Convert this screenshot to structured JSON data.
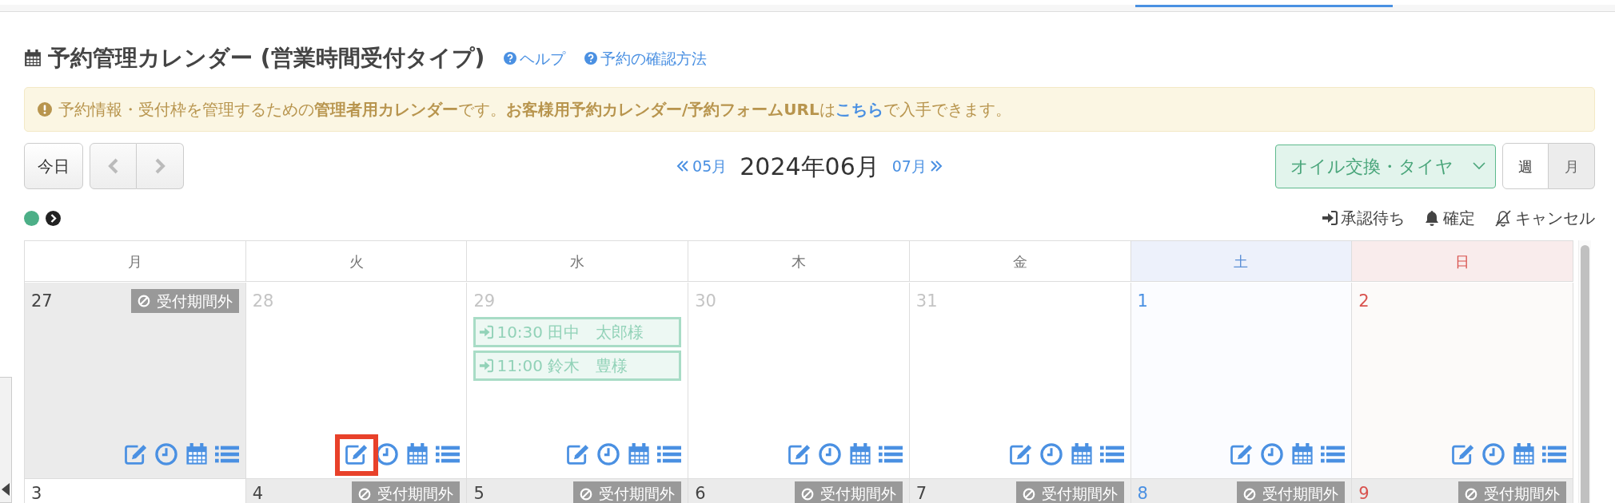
{
  "title": "予約管理カレンダー (営業時間受付タイプ)",
  "help_links": [
    "ヘルプ",
    "予約の確認方法"
  ],
  "notice": {
    "text": "予約情報・受付枠を管理するための**管理者用カレンダー**です。**お客様用予約カレンダー/予約フォームURL**は",
    "link": "こちら",
    "text_after": "で入手できます。"
  },
  "toolbar": {
    "today": "今日",
    "prev_month": "05月",
    "current_month": "2024年06月",
    "next_month": "07月",
    "category": "オイル交換・タイヤ",
    "views": [
      {
        "label": "週",
        "selected": false
      },
      {
        "label": "月",
        "selected": true
      }
    ]
  },
  "legend": [
    {
      "kind": "pending",
      "label": "承認待ち"
    },
    {
      "kind": "confirmed",
      "label": "確定"
    },
    {
      "kind": "cancelled",
      "label": "キャンセル"
    }
  ],
  "calendar": {
    "columns": [
      {
        "label": "月",
        "kind": "weekday"
      },
      {
        "label": "火",
        "kind": "weekday"
      },
      {
        "label": "水",
        "kind": "weekday"
      },
      {
        "label": "木",
        "kind": "weekday"
      },
      {
        "label": "金",
        "kind": "weekday"
      },
      {
        "label": "土",
        "kind": "saturday"
      },
      {
        "label": "日",
        "kind": "sunday"
      }
    ],
    "weeks": [
      {
        "days": [
          {
            "day": "27",
            "muted": false,
            "closed": true,
            "badge": "受付期間外",
            "tools": true
          },
          {
            "day": "28",
            "muted": true,
            "closed": false,
            "tools": true,
            "highlight": true
          },
          {
            "day": "29",
            "muted": true,
            "closed": false,
            "tools": true,
            "events": [
              {
                "kind": "pending",
                "text": "10:30 田中　太郎様"
              },
              {
                "kind": "pending",
                "text": "11:00 鈴木　豊様"
              }
            ]
          },
          {
            "day": "30",
            "muted": true,
            "closed": false,
            "tools": true
          },
          {
            "day": "31",
            "muted": true,
            "closed": false,
            "tools": true
          },
          {
            "day": "1",
            "muted": false,
            "closed": false,
            "tools": true
          },
          {
            "day": "2",
            "muted": false,
            "closed": false,
            "tools": true
          }
        ]
      },
      {
        "days": [
          {
            "day": "3",
            "muted": false,
            "closed": false
          },
          {
            "day": "4",
            "muted": false,
            "closed": true,
            "badge": "受付期間外"
          },
          {
            "day": "5",
            "muted": false,
            "closed": true,
            "badge": "受付期間外"
          },
          {
            "day": "6",
            "muted": false,
            "closed": true,
            "badge": "受付期間外"
          },
          {
            "day": "7",
            "muted": false,
            "closed": true,
            "badge": "受付期間外"
          },
          {
            "day": "8",
            "muted": false,
            "closed": true,
            "badge": "受付期間外"
          },
          {
            "day": "9",
            "muted": false,
            "closed": true,
            "badge": "受付期間外"
          }
        ]
      }
    ]
  }
}
